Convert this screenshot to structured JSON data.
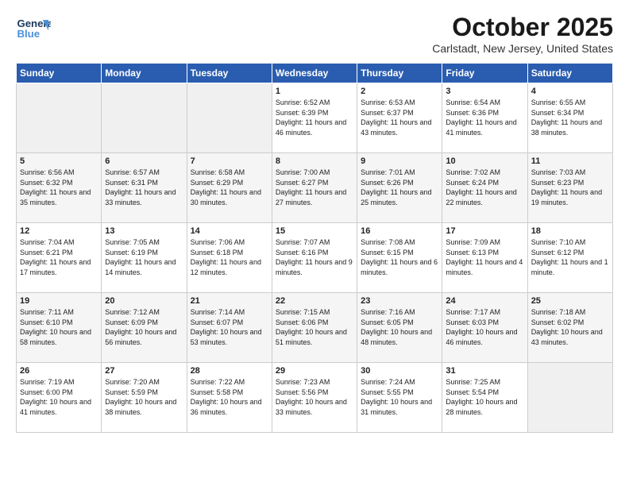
{
  "header": {
    "logo_line1": "General",
    "logo_line2": "Blue",
    "month_title": "October 2025",
    "location": "Carlstadt, New Jersey, United States"
  },
  "weekdays": [
    "Sunday",
    "Monday",
    "Tuesday",
    "Wednesday",
    "Thursday",
    "Friday",
    "Saturday"
  ],
  "weeks": [
    [
      {
        "day": "",
        "empty": true
      },
      {
        "day": "",
        "empty": true
      },
      {
        "day": "",
        "empty": true
      },
      {
        "day": "1",
        "sunrise": "6:52 AM",
        "sunset": "6:39 PM",
        "daylight": "11 hours and 46 minutes."
      },
      {
        "day": "2",
        "sunrise": "6:53 AM",
        "sunset": "6:37 PM",
        "daylight": "11 hours and 43 minutes."
      },
      {
        "day": "3",
        "sunrise": "6:54 AM",
        "sunset": "6:36 PM",
        "daylight": "11 hours and 41 minutes."
      },
      {
        "day": "4",
        "sunrise": "6:55 AM",
        "sunset": "6:34 PM",
        "daylight": "11 hours and 38 minutes."
      }
    ],
    [
      {
        "day": "5",
        "sunrise": "6:56 AM",
        "sunset": "6:32 PM",
        "daylight": "11 hours and 35 minutes."
      },
      {
        "day": "6",
        "sunrise": "6:57 AM",
        "sunset": "6:31 PM",
        "daylight": "11 hours and 33 minutes."
      },
      {
        "day": "7",
        "sunrise": "6:58 AM",
        "sunset": "6:29 PM",
        "daylight": "11 hours and 30 minutes."
      },
      {
        "day": "8",
        "sunrise": "7:00 AM",
        "sunset": "6:27 PM",
        "daylight": "11 hours and 27 minutes."
      },
      {
        "day": "9",
        "sunrise": "7:01 AM",
        "sunset": "6:26 PM",
        "daylight": "11 hours and 25 minutes."
      },
      {
        "day": "10",
        "sunrise": "7:02 AM",
        "sunset": "6:24 PM",
        "daylight": "11 hours and 22 minutes."
      },
      {
        "day": "11",
        "sunrise": "7:03 AM",
        "sunset": "6:23 PM",
        "daylight": "11 hours and 19 minutes."
      }
    ],
    [
      {
        "day": "12",
        "sunrise": "7:04 AM",
        "sunset": "6:21 PM",
        "daylight": "11 hours and 17 minutes."
      },
      {
        "day": "13",
        "sunrise": "7:05 AM",
        "sunset": "6:19 PM",
        "daylight": "11 hours and 14 minutes."
      },
      {
        "day": "14",
        "sunrise": "7:06 AM",
        "sunset": "6:18 PM",
        "daylight": "11 hours and 12 minutes."
      },
      {
        "day": "15",
        "sunrise": "7:07 AM",
        "sunset": "6:16 PM",
        "daylight": "11 hours and 9 minutes."
      },
      {
        "day": "16",
        "sunrise": "7:08 AM",
        "sunset": "6:15 PM",
        "daylight": "11 hours and 6 minutes."
      },
      {
        "day": "17",
        "sunrise": "7:09 AM",
        "sunset": "6:13 PM",
        "daylight": "11 hours and 4 minutes."
      },
      {
        "day": "18",
        "sunrise": "7:10 AM",
        "sunset": "6:12 PM",
        "daylight": "11 hours and 1 minute."
      }
    ],
    [
      {
        "day": "19",
        "sunrise": "7:11 AM",
        "sunset": "6:10 PM",
        "daylight": "10 hours and 58 minutes."
      },
      {
        "day": "20",
        "sunrise": "7:12 AM",
        "sunset": "6:09 PM",
        "daylight": "10 hours and 56 minutes."
      },
      {
        "day": "21",
        "sunrise": "7:14 AM",
        "sunset": "6:07 PM",
        "daylight": "10 hours and 53 minutes."
      },
      {
        "day": "22",
        "sunrise": "7:15 AM",
        "sunset": "6:06 PM",
        "daylight": "10 hours and 51 minutes."
      },
      {
        "day": "23",
        "sunrise": "7:16 AM",
        "sunset": "6:05 PM",
        "daylight": "10 hours and 48 minutes."
      },
      {
        "day": "24",
        "sunrise": "7:17 AM",
        "sunset": "6:03 PM",
        "daylight": "10 hours and 46 minutes."
      },
      {
        "day": "25",
        "sunrise": "7:18 AM",
        "sunset": "6:02 PM",
        "daylight": "10 hours and 43 minutes."
      }
    ],
    [
      {
        "day": "26",
        "sunrise": "7:19 AM",
        "sunset": "6:00 PM",
        "daylight": "10 hours and 41 minutes."
      },
      {
        "day": "27",
        "sunrise": "7:20 AM",
        "sunset": "5:59 PM",
        "daylight": "10 hours and 38 minutes."
      },
      {
        "day": "28",
        "sunrise": "7:22 AM",
        "sunset": "5:58 PM",
        "daylight": "10 hours and 36 minutes."
      },
      {
        "day": "29",
        "sunrise": "7:23 AM",
        "sunset": "5:56 PM",
        "daylight": "10 hours and 33 minutes."
      },
      {
        "day": "30",
        "sunrise": "7:24 AM",
        "sunset": "5:55 PM",
        "daylight": "10 hours and 31 minutes."
      },
      {
        "day": "31",
        "sunrise": "7:25 AM",
        "sunset": "5:54 PM",
        "daylight": "10 hours and 28 minutes."
      },
      {
        "day": "",
        "empty": true
      }
    ]
  ]
}
